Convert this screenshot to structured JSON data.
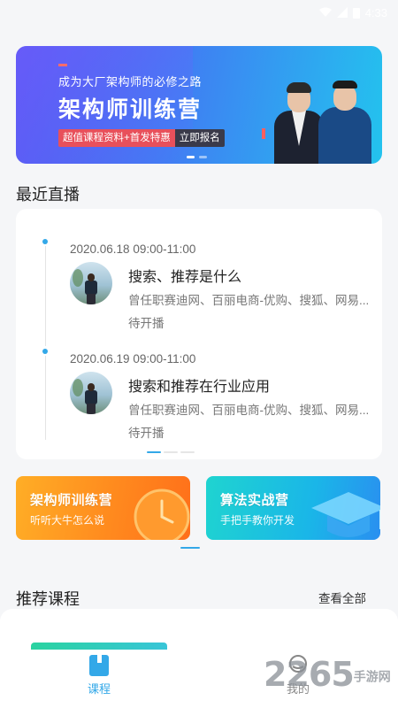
{
  "status_bar": {
    "time": "4:33"
  },
  "banner": {
    "subtitle": "成为大厂架构师的必修之路",
    "title": "架构师训练营",
    "tag_left": "超值课程资料+首发特惠",
    "tag_right": "立即报名"
  },
  "live": {
    "section_title": "最近直播",
    "items": [
      {
        "time": "2020.06.18 09:00-11:00",
        "name": "搜索、推荐是什么",
        "teacher": "曾任职赛迪网、百丽电商-优购、搜狐、网易...",
        "status": "待开播"
      },
      {
        "time": "2020.06.19 09:00-11:00",
        "name": "搜索和推荐在行业应用",
        "teacher": "曾任职赛迪网、百丽电商-优购、搜狐、网易...",
        "status": "待开播"
      }
    ]
  },
  "camps": [
    {
      "title": "架构师训练营",
      "subtitle": "听听大牛怎么说"
    },
    {
      "title": "算法实战营",
      "subtitle": "手把手教你开发"
    }
  ],
  "recommend": {
    "section_title": "推荐课程",
    "see_all": "查看全部"
  },
  "tabbar": {
    "course": "课程",
    "me": "我的"
  },
  "watermark": {
    "text": "2265",
    "suffix": "手游网"
  },
  "colors": {
    "accent": "#33a8e8",
    "orange": "#ff8a1e",
    "cyan": "#1fd4d0"
  }
}
